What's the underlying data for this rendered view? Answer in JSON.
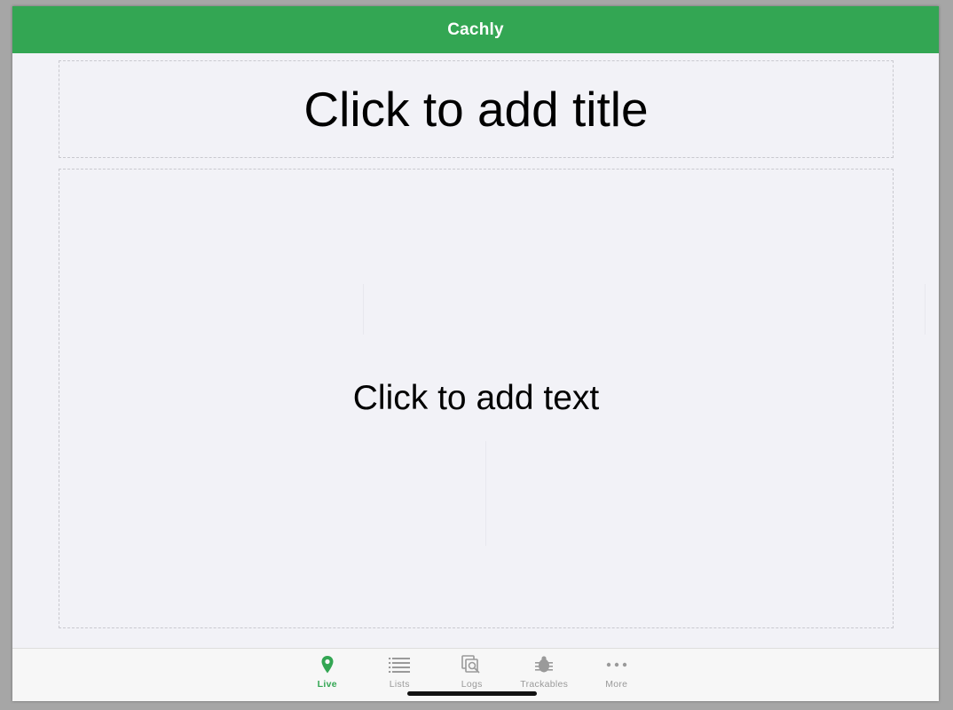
{
  "app": {
    "title": "Cachly"
  },
  "content": {
    "title_placeholder": "Click to add title",
    "text_placeholder": "Click to add text"
  },
  "tabs": [
    {
      "label": "Live",
      "icon": "map-pin-icon",
      "active": true
    },
    {
      "label": "Lists",
      "icon": "list-icon",
      "active": false
    },
    {
      "label": "Logs",
      "icon": "logs-icon",
      "active": false
    },
    {
      "label": "Trackables",
      "icon": "trackable-bug-icon",
      "active": false
    },
    {
      "label": "More",
      "icon": "more-dots-icon",
      "active": false
    }
  ],
  "colors": {
    "accent": "#33a653",
    "inactive": "#9a9a9a",
    "background": "#f2f2f7"
  }
}
